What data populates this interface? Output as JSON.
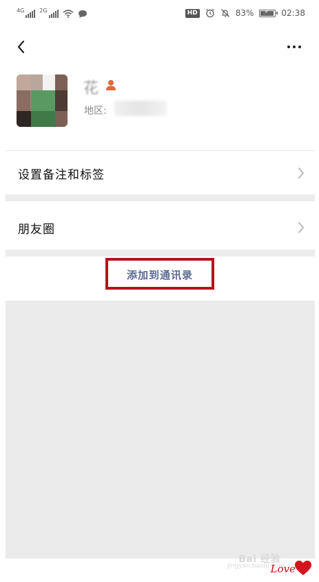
{
  "status_bar": {
    "net1": "4G",
    "net2": "2G",
    "hd": "HD",
    "battery_percent": "83%",
    "battery_level": 0.83,
    "time": "02:38"
  },
  "nav": {
    "back_icon": "chevron-left-icon",
    "more_icon": "more-horizontal-icon"
  },
  "profile": {
    "name": "花",
    "region_label": "地区:",
    "gender_icon": "person-icon",
    "gender_color": "#e2673b"
  },
  "menu": {
    "items": [
      {
        "label": "设置备注和标签"
      },
      {
        "label": "朋友圈"
      }
    ]
  },
  "actions": {
    "add_contact": "添加到通讯录",
    "highlight_color": "#b3141b",
    "text_color": "#5b6b93"
  },
  "watermark": {
    "brand": "Bai 经验",
    "sub": "jingyan.baidu.com",
    "love": "Love"
  }
}
